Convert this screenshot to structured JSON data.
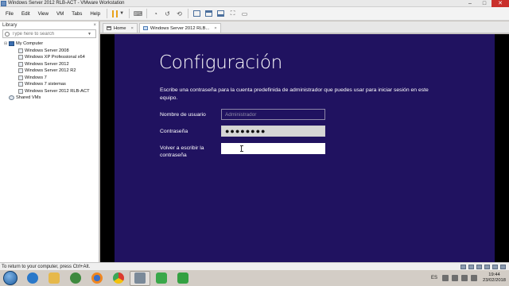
{
  "window": {
    "title": "Windows Server 2012 RLB-ACT - VMware Workstation",
    "controls": {
      "minimize": "–",
      "maximize": "□",
      "close": "✕"
    }
  },
  "menubar": {
    "items": [
      "File",
      "Edit",
      "View",
      "VM",
      "Tabs",
      "Help"
    ]
  },
  "library": {
    "header": "Library",
    "close_glyph": "×",
    "search_placeholder": "Type here to search",
    "tree": {
      "root": "My Computer",
      "vms": [
        "Windows Server 2008",
        "Windows XP Professional x64",
        "Windows Server 2012",
        "Windows Server 2012 R2",
        "Windows 7",
        "Windows 7 sistemas",
        "Windows Server 2012 RLB-ACT"
      ],
      "shared": "Shared VMs"
    }
  },
  "tabs": {
    "home": "Home",
    "vm": "Windows Server 2012 RLB..."
  },
  "guest": {
    "heading": "Configuración",
    "description": "Escribe una contraseña para la cuenta predefinida de administrador que puedes usar para iniciar sesión en este equipo.",
    "username_label": "Nombre de usuario",
    "username_placeholder": "Administrador",
    "password_label": "Contraseña",
    "password_value": "●●●●●●●●",
    "confirm_label": "Volver a escribir la contraseña",
    "confirm_value": ""
  },
  "statusbar": {
    "hint": "To return to your computer, press Ctrl+Alt."
  },
  "taskbar": {
    "language": "ES",
    "time": "19:44",
    "date": "23/02/2018"
  }
}
